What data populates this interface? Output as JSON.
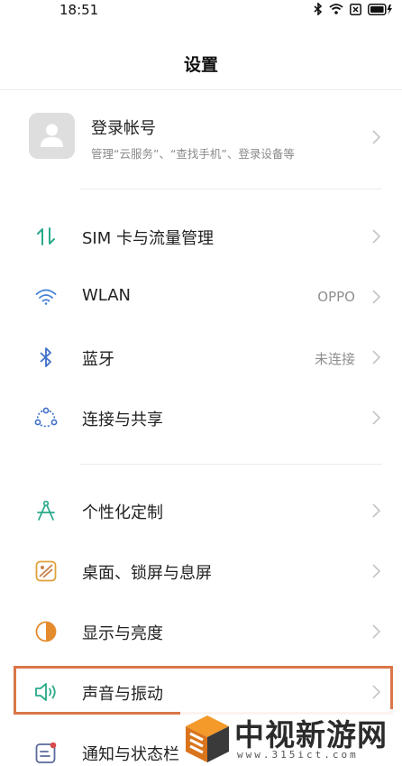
{
  "status_bar": {
    "time": "18:51",
    "icons": [
      "bluetooth-icon",
      "wifi-icon",
      "sim-x-icon",
      "battery-charging-icon"
    ]
  },
  "header": {
    "title": "设置"
  },
  "account": {
    "title": "登录帐号",
    "subtitle": "管理“云服务”、“查找手机”、登录设备等",
    "icon": "user-avatar-icon"
  },
  "groups": [
    {
      "items": [
        {
          "label": "SIM 卡与流量管理",
          "value": "",
          "icon": "sim-traffic-icon",
          "color": "#2aa98a"
        },
        {
          "label": "WLAN",
          "value": "OPPO",
          "icon": "wifi-icon",
          "color": "#3f7fd6"
        },
        {
          "label": "蓝牙",
          "value": "未连接",
          "icon": "bluetooth-icon",
          "color": "#3f6fc8"
        },
        {
          "label": "连接与共享",
          "value": "",
          "icon": "share-connect-icon",
          "color": "#3f6fc8"
        }
      ]
    },
    {
      "items": [
        {
          "label": "个性化定制",
          "value": "",
          "icon": "compass-icon",
          "color": "#2aa98a"
        },
        {
          "label": "桌面、锁屏与息屏",
          "value": "",
          "icon": "wallpaper-icon",
          "color": "#e0a13a"
        },
        {
          "label": "显示与亮度",
          "value": "",
          "icon": "brightness-icon",
          "color": "#e38b2d"
        },
        {
          "label": "声音与振动",
          "value": "",
          "icon": "speaker-icon",
          "color": "#2aa98a"
        },
        {
          "label": "通知与状态栏",
          "value": "",
          "icon": "notification-icon",
          "color": "#d94a4a"
        }
      ]
    }
  ],
  "highlight_color": "#d97748",
  "watermark": {
    "title": "中视新游网",
    "url": "www.315ict.com"
  }
}
